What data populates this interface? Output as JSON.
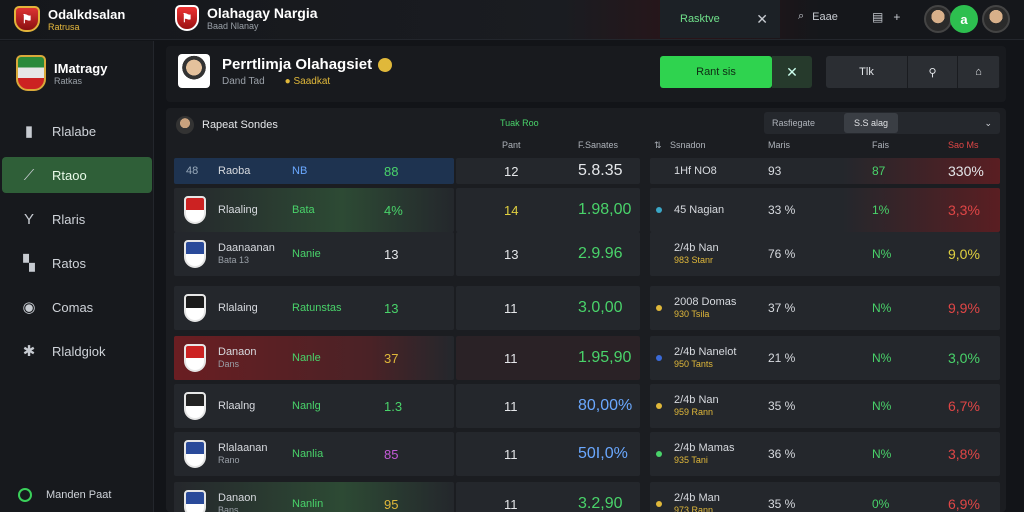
{
  "brand": {
    "title": "Odalkdsalan",
    "subtitle": "Ratrusa"
  },
  "app": {
    "title": "Olahagay Nargia",
    "subtitle": "Baad Nlanay"
  },
  "topbar": {
    "tab_label": "Rasktve",
    "search_label": "Eaae",
    "avatar_initial": "a"
  },
  "team": {
    "name": "IMatragy",
    "sub": "Ratkas"
  },
  "nav": [
    {
      "label": "Rlalabe",
      "icon": "bar-chart-icon",
      "glyph": "▮",
      "active": false
    },
    {
      "label": "Rtaoo",
      "icon": "trend-icon",
      "glyph": "⟋",
      "active": true
    },
    {
      "label": "Rlaris",
      "icon": "filter-icon",
      "glyph": "Y",
      "active": false
    },
    {
      "label": "Ratos",
      "icon": "grid-icon",
      "glyph": "▚",
      "active": false
    },
    {
      "label": "Comas",
      "icon": "ball-icon",
      "glyph": "◉",
      "active": false
    },
    {
      "label": "Rlaldgiok",
      "icon": "star-icon",
      "glyph": "✱",
      "active": false
    }
  ],
  "sidebar_footer": "Manden Paat",
  "player": {
    "title": "Perrtlimja Olahagsiet",
    "sub1": "Dand Tad",
    "sub2": "Saadkat"
  },
  "actions": {
    "primary": "Rant sis",
    "secondary": "Tlk"
  },
  "table": {
    "owner": "Rapeat Sondes",
    "category": "Tuak Roo",
    "filter_label": "Rasfiegate",
    "filter_value": "S.S alag",
    "headers_left": {
      "pos": "Pant",
      "value": "F.Sanates"
    },
    "headers_right": {
      "name": "Ssnadon",
      "value": "Maris",
      "mid": "Fais",
      "pct": "Sao Ms"
    },
    "rows": [
      {
        "num": "48",
        "name": "Raoba",
        "sub": "",
        "role": "NB",
        "score": "88",
        "pos": "12",
        "value": "5.8.35",
        "r_name": "1Hf NO8",
        "r_sub": "",
        "r_val": "93",
        "r_mid": "87",
        "r_pct": "330%",
        "tone": "header"
      },
      {
        "num": "",
        "name": "Rlaaling",
        "sub": "",
        "role": "Bata",
        "score": "4%",
        "pos": "14",
        "value": "1.98,00",
        "r_name": "45 Nagian",
        "r_sub": "",
        "r_val": "33 %",
        "r_mid": "1%",
        "r_pct": "3,3%",
        "tone": "green"
      },
      {
        "num": "",
        "name": "Daanaanan",
        "sub": "Bata 13",
        "role": "Nanie",
        "score": "13",
        "pos": "13",
        "value": "2.9.96",
        "r_name": "2/4b Nan",
        "r_sub": "983 Stanr",
        "r_val": "76 %",
        "r_mid": "N%",
        "r_pct": "9,0%",
        "tone": "plain"
      },
      {
        "num": "",
        "name": "Rlalaing",
        "sub": "",
        "role": "Ratunstas",
        "score": "13",
        "pos": "11",
        "value": "3.0,00",
        "r_name": "2008 Domas",
        "r_sub": "930 Tsila",
        "r_val": "37 %",
        "r_mid": "N%",
        "r_pct": "9,9%",
        "tone": "plain"
      },
      {
        "num": "",
        "name": "Danaon",
        "sub": "Dans",
        "role": "Nanle",
        "score": "37",
        "pos": "11",
        "value": "1.95,90",
        "r_name": "2/4b Nanelot",
        "r_sub": "950 Tants",
        "r_val": "21 %",
        "r_mid": "N%",
        "r_pct": "3,0%",
        "tone": "red"
      },
      {
        "num": "",
        "name": "Rlaalng",
        "sub": "",
        "role": "Nanlg",
        "score": "1.3",
        "pos": "11",
        "value": "80,00%",
        "r_name": "2/4b Nan",
        "r_sub": "959 Rann",
        "r_val": "35 %",
        "r_mid": "N%",
        "r_pct": "6,7%",
        "tone": "plain"
      },
      {
        "num": "",
        "name": "Rlalaanan",
        "sub": "Rano",
        "role": "Nanlia",
        "score": "85",
        "pos": "11",
        "value": "50I,0%",
        "r_name": "2/4b Mamas",
        "r_sub": "935 Tani",
        "r_val": "36 %",
        "r_mid": "N%",
        "r_pct": "3,8%",
        "tone": "plain"
      },
      {
        "num": "",
        "name": "Danaon",
        "sub": "Bans",
        "role": "Nanlin",
        "score": "95",
        "pos": "11",
        "value": "3.2,90",
        "r_name": "2/4b Man",
        "r_sub": "973 Rann",
        "r_val": "35 %",
        "r_mid": "0%",
        "r_pct": "6,9%",
        "tone": "green"
      }
    ]
  },
  "colors": {
    "accent": "#2fd34f",
    "warn": "#e0b83a",
    "danger": "#e04646",
    "panel": "#1b1d21"
  }
}
